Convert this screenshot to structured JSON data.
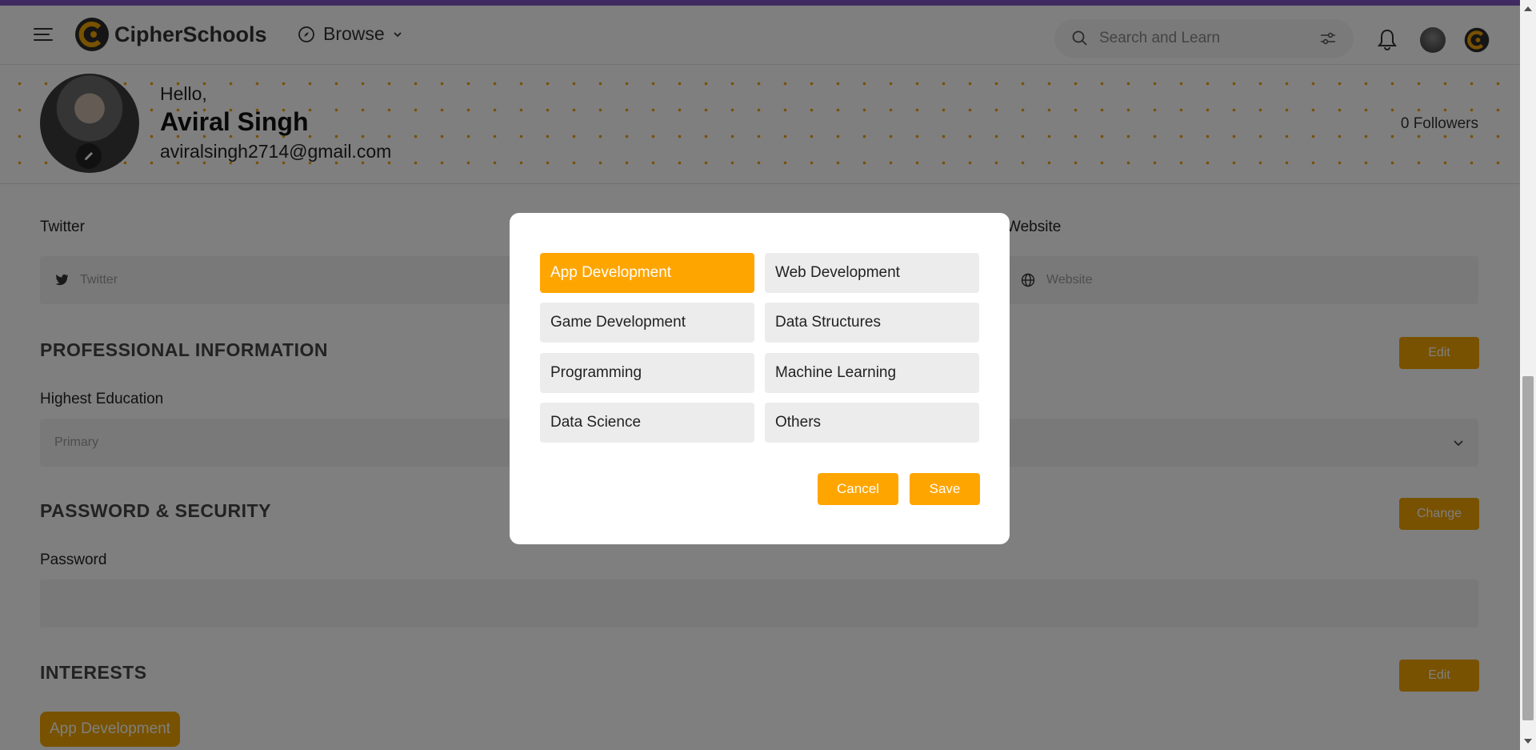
{
  "header": {
    "brand": "CipherSchools",
    "browse_label": "Browse",
    "search_placeholder": "Search and Learn"
  },
  "profile": {
    "greeting": "Hello,",
    "name": "Aviral Singh",
    "email": "aviralsingh2714@gmail.com",
    "followers": "0 Followers"
  },
  "socials": {
    "twitter_label": "Twitter",
    "twitter_placeholder": "Twitter",
    "website_label": "Website",
    "website_placeholder": "Website"
  },
  "professional": {
    "title": "PROFESSIONAL INFORMATION",
    "edit_label": "Edit",
    "education_label": "Highest Education",
    "education_value": "Primary"
  },
  "security": {
    "title": "PASSWORD & SECURITY",
    "change_label": "Change",
    "password_label": "Password"
  },
  "interests": {
    "title": "INTERESTS",
    "edit_label": "Edit",
    "selected_chip": "App Development"
  },
  "modal": {
    "options": [
      {
        "label": "App Development",
        "selected": true
      },
      {
        "label": "Web Development",
        "selected": false
      },
      {
        "label": "Game Development",
        "selected": false
      },
      {
        "label": "Data Structures",
        "selected": false
      },
      {
        "label": "Programming",
        "selected": false
      },
      {
        "label": "Machine Learning",
        "selected": false
      },
      {
        "label": "Data Science",
        "selected": false
      },
      {
        "label": "Others",
        "selected": false
      }
    ],
    "cancel_label": "Cancel",
    "save_label": "Save"
  },
  "colors": {
    "accent": "#ffa500",
    "top_strip": "#7e57c2",
    "overlay": "rgba(0,0,0,0.5)"
  }
}
